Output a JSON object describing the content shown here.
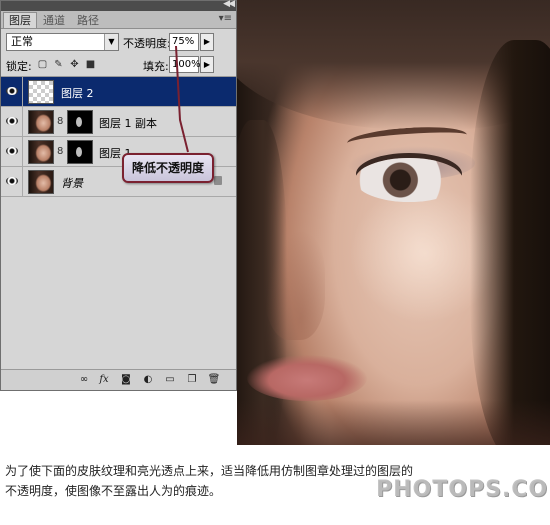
{
  "panel": {
    "tabs": [
      {
        "label": "图层",
        "active": true
      },
      {
        "label": "通道",
        "active": false
      },
      {
        "label": "路径",
        "active": false
      }
    ],
    "blend_mode": "正常",
    "opacity_label": "不透明度:",
    "opacity_value": "75%",
    "lock_label": "锁定:",
    "fill_label": "填充:",
    "fill_value": "100%",
    "layers": [
      {
        "name": "图层 2",
        "selected": true,
        "thumb": "transparent",
        "has_mask": false
      },
      {
        "name": "图层 1 副本",
        "selected": false,
        "thumb": "face",
        "has_mask": true
      },
      {
        "name": "图层 1",
        "selected": false,
        "thumb": "face",
        "has_mask": true
      },
      {
        "name": "背景",
        "selected": false,
        "thumb": "face",
        "has_mask": false,
        "locked": true
      }
    ],
    "footer_icons": [
      "link-icon",
      "fx-icon",
      "mask-icon",
      "adjustment-icon",
      "group-icon",
      "new-layer-icon",
      "trash-icon"
    ]
  },
  "annotation": {
    "callout_text": "降低不透明度",
    "callout_border": "#7a2130"
  },
  "caption": {
    "line1": "为了使下面的皮肤纹理和亮光透点上来，适当降低用仿制图章处理过的图层的",
    "line2": "不透明度，使图像不至露出人为的痕迹。"
  },
  "watermark": "PHOTOPS.COM",
  "colors": {
    "selection": "#0b2a6e",
    "panel_bg": "#d6d6d6"
  }
}
